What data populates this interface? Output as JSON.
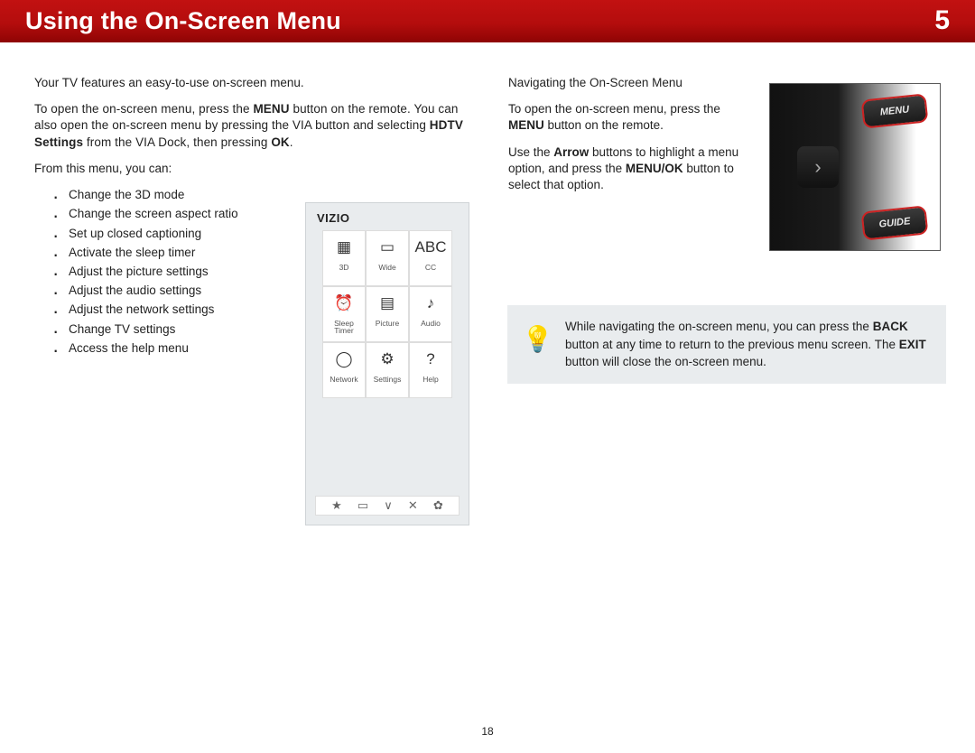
{
  "header": {
    "title": "Using the On-Screen Menu",
    "chapter": "5"
  },
  "left": {
    "intro": "Your TV features an easy-to-use on-screen menu.",
    "open_a": "To open the on-screen menu, press the ",
    "open_b": " button on the remote. You can also open the on-screen menu by pressing the VIA button and selecting ",
    "open_c": " from the VIA Dock, then pressing ",
    "open_d": ".",
    "bold_menu": "MENU",
    "bold_hdtv": "HDTV Settings",
    "bold_ok": "OK",
    "listlead": "From this menu, you can:",
    "items": [
      "Change the 3D mode",
      "Change the screen aspect ratio",
      "Set up closed captioning",
      "Activate the sleep timer",
      "Adjust the picture settings",
      "Adjust the audio settings",
      "Adjust the network settings",
      "Change TV settings",
      "Access the help menu"
    ]
  },
  "menu": {
    "brand": "VIZIO",
    "cells": [
      {
        "name": "3d-icon",
        "glyph": "▦",
        "label": "3D"
      },
      {
        "name": "wide-icon",
        "glyph": "▭",
        "label": "Wide"
      },
      {
        "name": "cc-icon",
        "glyph": "ABC",
        "label": "CC"
      },
      {
        "name": "sleep-icon",
        "glyph": "⏰",
        "label": "Sleep\nTimer"
      },
      {
        "name": "picture-icon",
        "glyph": "▤",
        "label": "Picture"
      },
      {
        "name": "audio-icon",
        "glyph": "♪",
        "label": "Audio"
      },
      {
        "name": "network-icon",
        "glyph": "◯",
        "label": "Network"
      },
      {
        "name": "settings-icon",
        "glyph": "⚙",
        "label": "Settings"
      },
      {
        "name": "help-icon",
        "glyph": "?",
        "label": "Help"
      }
    ],
    "footer": [
      "★",
      "▭",
      "∨",
      "✕",
      "✿"
    ]
  },
  "right": {
    "heading": "Navigating the On-Screen Menu",
    "p1a": "To open the on-screen menu, press the ",
    "p1b": " button on the remote.",
    "p2a": "Use the ",
    "p2b": " buttons to highlight a menu option, and press the ",
    "p2c": " button to select that option.",
    "bold_menu": "MENU",
    "bold_arrow": "Arrow",
    "bold_menuok": "MENU/OK",
    "remote": {
      "menu": "MENU",
      "guide": "GUIDE"
    }
  },
  "tip": {
    "a": "While navigating the on-screen menu, you can press the ",
    "b": " button at any time to return to the previous menu screen. The ",
    "c": " button will close the on-screen menu.",
    "bold_back": "BACK",
    "bold_exit": "EXIT"
  },
  "page_number": "18"
}
